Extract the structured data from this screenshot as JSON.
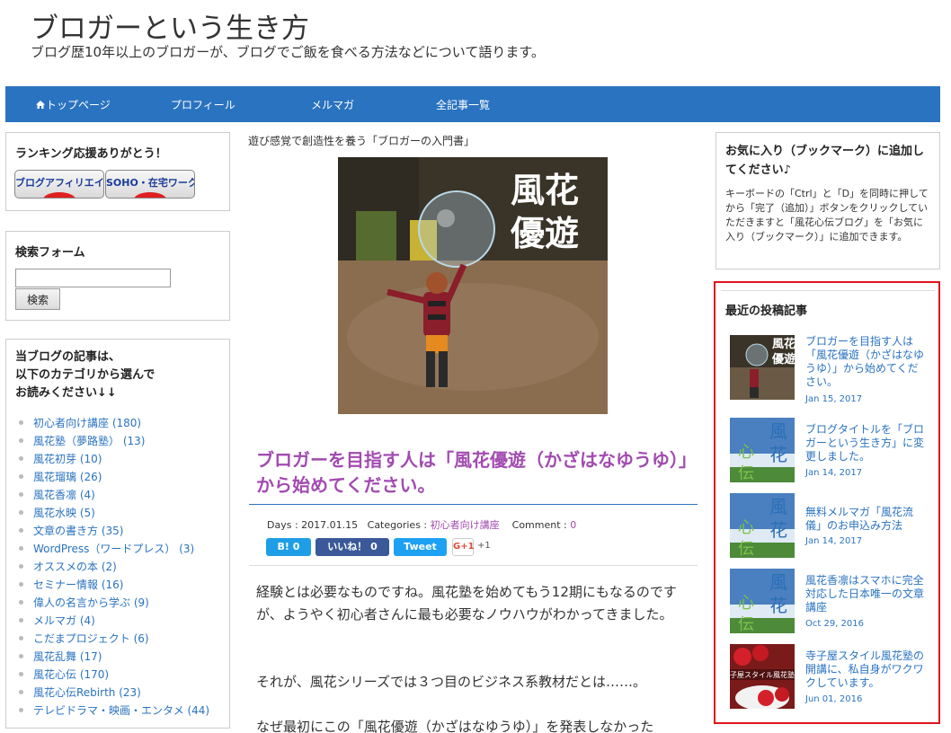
{
  "site": {
    "title": "ブロガーという生き方",
    "description": "ブログ歴10年以上のブロガーが、ブログでご飯を食べる方法などについて語ります。"
  },
  "nav": {
    "items": [
      {
        "label": "トップページ",
        "icon": "home-icon"
      },
      {
        "label": "プロフィール"
      },
      {
        "label": "メルマガ"
      },
      {
        "label": "全記事一覧"
      }
    ]
  },
  "sidebar_left": {
    "ranking": {
      "title": "ランキング応援ありがとう！",
      "banners": [
        "ブログアフィリエイト",
        "SOHO・在宅ワーク"
      ]
    },
    "search": {
      "title": "検索フォーム",
      "input_value": "",
      "button_label": "検索"
    },
    "categories": {
      "title_lines": [
        "当ブログの記事は、",
        "以下のカテゴリから選んで",
        "お読みください↓↓"
      ],
      "items": [
        "初心者向け講座 (180)",
        "風花塾（夢路塾） (13)",
        "風花初芽 (10)",
        "風花瑠璃 (26)",
        "風花香凛 (4)",
        "風花水映 (5)",
        "文章の書き方 (35)",
        "WordPress（ワードプレス） (3)",
        "オススメの本 (2)",
        "セミナー情報 (16)",
        "偉人の名言から学ぶ (9)",
        "メルマガ (4)",
        "こだまプロジェクト (6)",
        "風花乱舞 (17)",
        "風花心伝 (170)",
        "風花心伝Rebirth (23)",
        "テレビドラマ・映画・エンタメ (44)"
      ]
    }
  },
  "main": {
    "caption": "遊び感覚で創造性を養う「ブロガーの入門書」",
    "image_text": [
      "風花",
      "優遊"
    ],
    "post_title": "ブロガーを目指す人は「風花優遊（かざはなゆうゆ）」から始めてください。",
    "meta": {
      "days_label": "Days :",
      "date": "2017.01.15",
      "categories_label": "Categories :",
      "category": "初心者向け講座",
      "comment_label": "Comment :",
      "comment_count": "0"
    },
    "share": {
      "hatena": "B! 0",
      "facebook": "いいね！ 0",
      "twitter": "Tweet",
      "gplus": "G+1",
      "gplus_count": "+1"
    },
    "paragraphs": [
      "経験とは必要なものですね。風花塾を始めてもう12期にもなるのですが、ようやく初心者さんに最も必要なノウハウがわかってきました。",
      "それが、風花シリーズでは３つ目のビジネス系教材だとは……。",
      "なぜ最初にこの「風花優遊（かざはなゆうゆ）」を発表しなかった"
    ]
  },
  "sidebar_right": {
    "bookmark": {
      "title": "お気に入り（ブックマーク）に追加してください♪",
      "text": "キーボードの「Ctrl」と「D」を同時に押してから「完了（追加）」ボタンをクリックしていただきますと「風花心伝ブログ」を「お気に入り（ブックマーク）」に追加できます。"
    },
    "recent": {
      "title": "最近の投稿記事",
      "items": [
        {
          "title": "ブロガーを目指す人は「風花優遊（かざはなゆうゆ）」から始めてください。",
          "date": "Jan 15, 2017",
          "thumb_text": "風花優遊"
        },
        {
          "title": "ブログタイトルを「ブロガーという生き方」に変更しました。",
          "date": "Jan 14, 2017",
          "thumb_text": "風花心伝"
        },
        {
          "title": "無料メルマガ「風花流儀」のお申込み方法",
          "date": "Jan 14, 2017",
          "thumb_text": "風花心伝"
        },
        {
          "title": "風花香凛はスマホに完全対応した日本唯一の文章講座",
          "date": "Oct 29, 2016",
          "thumb_text": "風花心伝"
        },
        {
          "title": "寺子屋スタイル風花塾の開講に、私自身がワクワクしています。",
          "date": "Jun 01, 2016",
          "thumb_text": "子屋スタイル風花塾"
        }
      ]
    }
  },
  "colors": {
    "nav_bg": "#2a73c0",
    "link": "#2a73c0",
    "post_title": "#a24bb0",
    "highlight_border": "#e0141e"
  }
}
